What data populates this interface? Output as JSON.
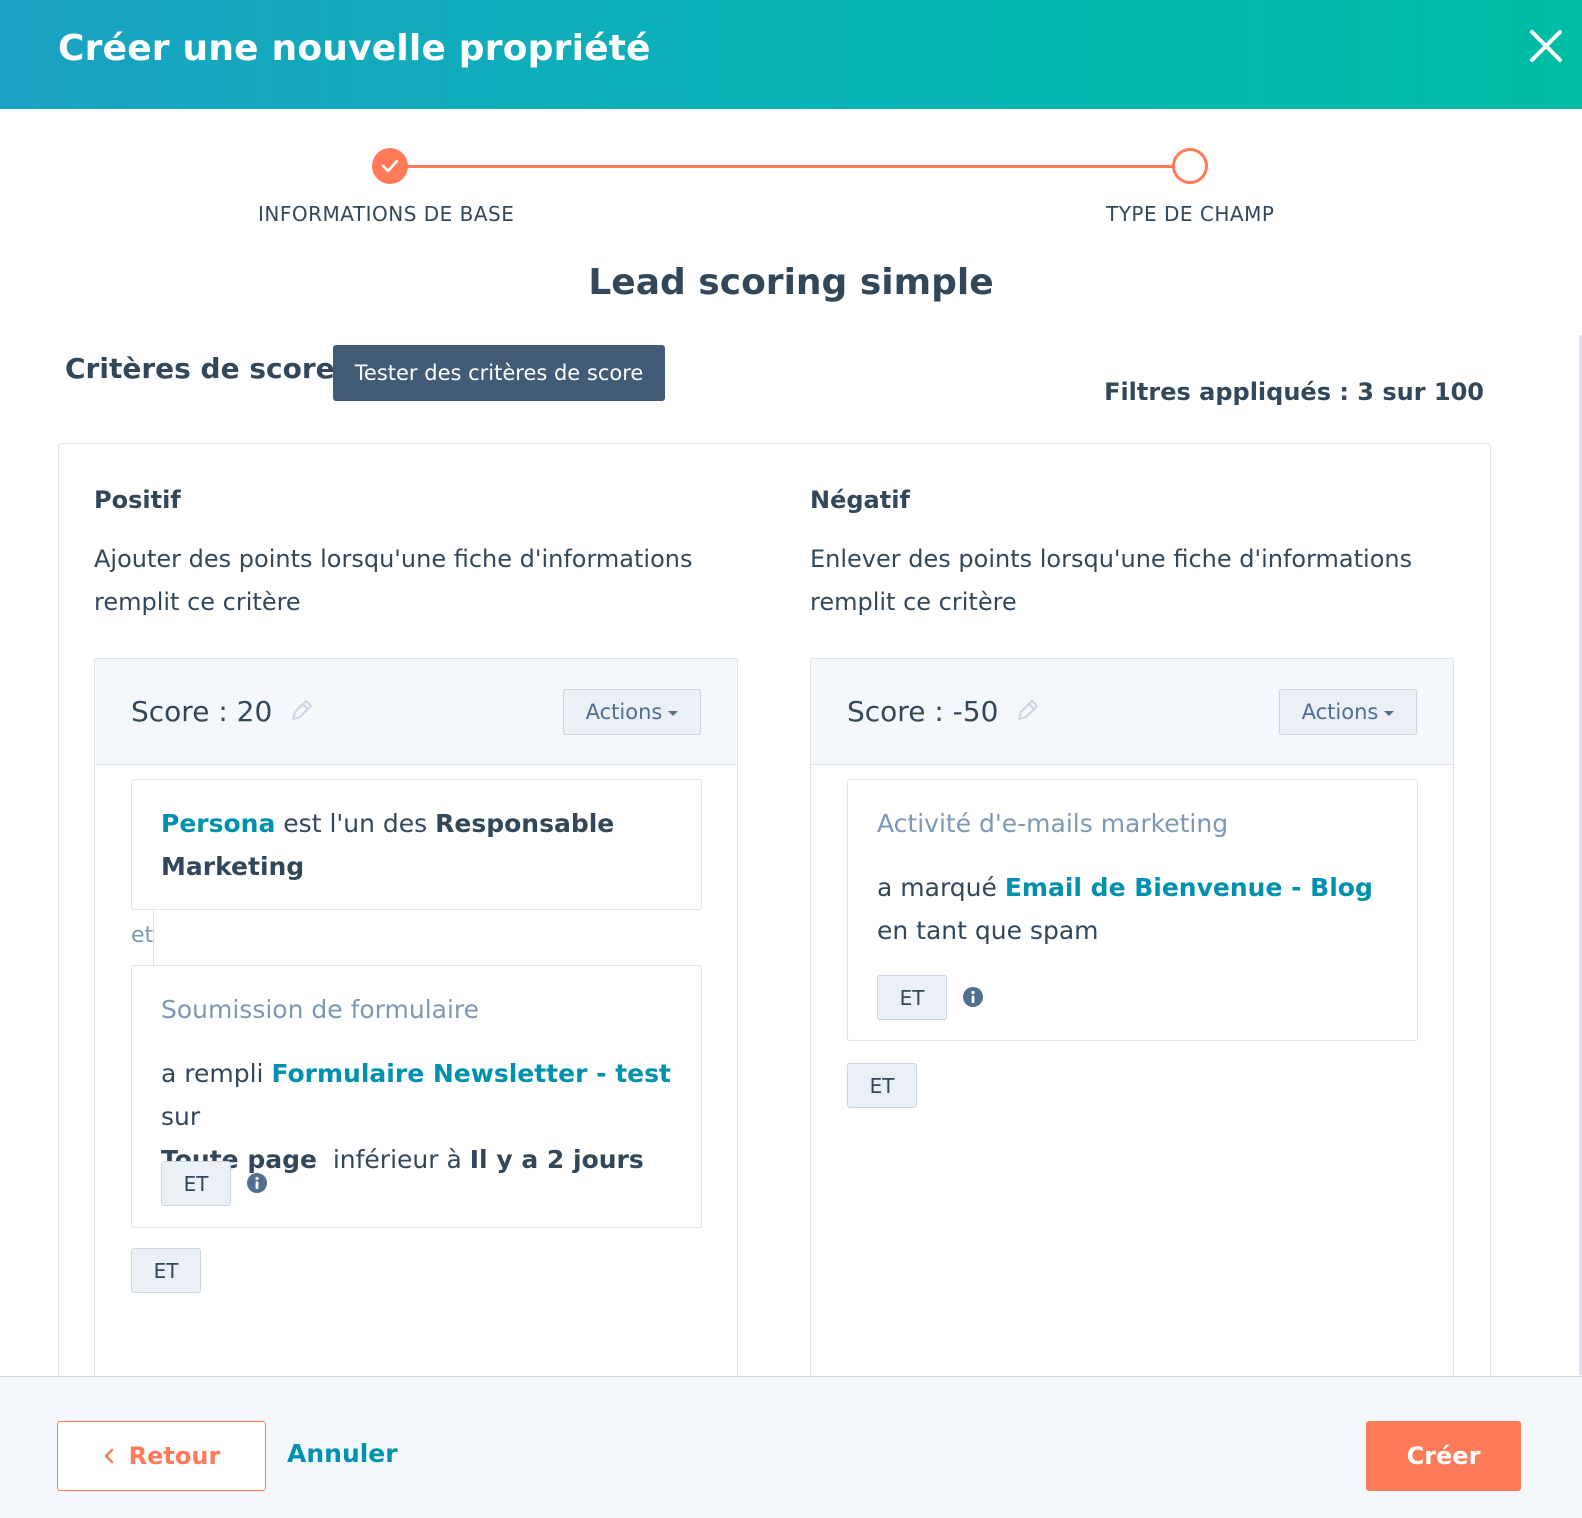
{
  "header": {
    "title": "Créer une nouvelle propriété"
  },
  "stepper": {
    "steps": [
      {
        "label": "INFORMATIONS DE BASE",
        "status": "done"
      },
      {
        "label": "TYPE DE CHAMP",
        "status": "current"
      }
    ]
  },
  "main": {
    "title": "Lead scoring simple",
    "criteria_title": "Critères de score",
    "test_button": "Tester des critères de score",
    "filters_applied": "Filtres appliqués : 3 sur 100"
  },
  "positive": {
    "title": "Positif",
    "description": "Ajouter des points lorsqu'une fiche d'informations remplit ce critère",
    "score_label": "Score : 20",
    "actions_label": "Actions",
    "criterion1": {
      "prop": "Persona",
      "op": " est l'un des ",
      "value": "Responsable Marketing"
    },
    "connector": "et",
    "criterion2": {
      "type": "Soumission de formulaire",
      "prefix": "a rempli ",
      "form": "Formulaire Newsletter - test",
      "mid": " sur",
      "page": "Toute page",
      "op": "  inférieur à ",
      "date": "Il y a 2 jours",
      "and_label": "ET"
    },
    "and_label": "ET"
  },
  "negative": {
    "title": "Négatif",
    "description": "Enlever des points lorsqu'une fiche d'informations remplit ce critère",
    "score_label": "Score : -50",
    "actions_label": "Actions",
    "criterion1": {
      "type": "Activité d'e-mails marketing",
      "prefix": "a marqué ",
      "email": "Email de Bienvenue - Blog",
      "suffix": " en tant que spam",
      "and_label": "ET"
    },
    "and_label": "ET"
  },
  "footer": {
    "back": "Retour",
    "cancel": "Annuler",
    "create": "Créer"
  },
  "colors": {
    "accent": "#ff7a59",
    "link": "#0091ae",
    "text": "#33475b",
    "header_start": "#1ba2c2",
    "header_end": "#00bda5"
  }
}
